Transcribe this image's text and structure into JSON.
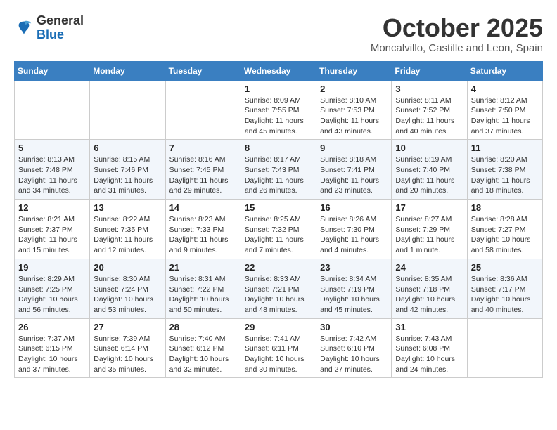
{
  "logo": {
    "general": "General",
    "blue": "Blue"
  },
  "title": "October 2025",
  "location": "Moncalvillo, Castille and Leon, Spain",
  "days_of_week": [
    "Sunday",
    "Monday",
    "Tuesday",
    "Wednesday",
    "Thursday",
    "Friday",
    "Saturday"
  ],
  "weeks": [
    [
      {
        "day": "",
        "info": ""
      },
      {
        "day": "",
        "info": ""
      },
      {
        "day": "",
        "info": ""
      },
      {
        "day": "1",
        "sunrise": "Sunrise: 8:09 AM",
        "sunset": "Sunset: 7:55 PM",
        "daylight": "Daylight: 11 hours and 45 minutes."
      },
      {
        "day": "2",
        "sunrise": "Sunrise: 8:10 AM",
        "sunset": "Sunset: 7:53 PM",
        "daylight": "Daylight: 11 hours and 43 minutes."
      },
      {
        "day": "3",
        "sunrise": "Sunrise: 8:11 AM",
        "sunset": "Sunset: 7:52 PM",
        "daylight": "Daylight: 11 hours and 40 minutes."
      },
      {
        "day": "4",
        "sunrise": "Sunrise: 8:12 AM",
        "sunset": "Sunset: 7:50 PM",
        "daylight": "Daylight: 11 hours and 37 minutes."
      }
    ],
    [
      {
        "day": "5",
        "sunrise": "Sunrise: 8:13 AM",
        "sunset": "Sunset: 7:48 PM",
        "daylight": "Daylight: 11 hours and 34 minutes."
      },
      {
        "day": "6",
        "sunrise": "Sunrise: 8:15 AM",
        "sunset": "Sunset: 7:46 PM",
        "daylight": "Daylight: 11 hours and 31 minutes."
      },
      {
        "day": "7",
        "sunrise": "Sunrise: 8:16 AM",
        "sunset": "Sunset: 7:45 PM",
        "daylight": "Daylight: 11 hours and 29 minutes."
      },
      {
        "day": "8",
        "sunrise": "Sunrise: 8:17 AM",
        "sunset": "Sunset: 7:43 PM",
        "daylight": "Daylight: 11 hours and 26 minutes."
      },
      {
        "day": "9",
        "sunrise": "Sunrise: 8:18 AM",
        "sunset": "Sunset: 7:41 PM",
        "daylight": "Daylight: 11 hours and 23 minutes."
      },
      {
        "day": "10",
        "sunrise": "Sunrise: 8:19 AM",
        "sunset": "Sunset: 7:40 PM",
        "daylight": "Daylight: 11 hours and 20 minutes."
      },
      {
        "day": "11",
        "sunrise": "Sunrise: 8:20 AM",
        "sunset": "Sunset: 7:38 PM",
        "daylight": "Daylight: 11 hours and 18 minutes."
      }
    ],
    [
      {
        "day": "12",
        "sunrise": "Sunrise: 8:21 AM",
        "sunset": "Sunset: 7:37 PM",
        "daylight": "Daylight: 11 hours and 15 minutes."
      },
      {
        "day": "13",
        "sunrise": "Sunrise: 8:22 AM",
        "sunset": "Sunset: 7:35 PM",
        "daylight": "Daylight: 11 hours and 12 minutes."
      },
      {
        "day": "14",
        "sunrise": "Sunrise: 8:23 AM",
        "sunset": "Sunset: 7:33 PM",
        "daylight": "Daylight: 11 hours and 9 minutes."
      },
      {
        "day": "15",
        "sunrise": "Sunrise: 8:25 AM",
        "sunset": "Sunset: 7:32 PM",
        "daylight": "Daylight: 11 hours and 7 minutes."
      },
      {
        "day": "16",
        "sunrise": "Sunrise: 8:26 AM",
        "sunset": "Sunset: 7:30 PM",
        "daylight": "Daylight: 11 hours and 4 minutes."
      },
      {
        "day": "17",
        "sunrise": "Sunrise: 8:27 AM",
        "sunset": "Sunset: 7:29 PM",
        "daylight": "Daylight: 11 hours and 1 minute."
      },
      {
        "day": "18",
        "sunrise": "Sunrise: 8:28 AM",
        "sunset": "Sunset: 7:27 PM",
        "daylight": "Daylight: 10 hours and 58 minutes."
      }
    ],
    [
      {
        "day": "19",
        "sunrise": "Sunrise: 8:29 AM",
        "sunset": "Sunset: 7:25 PM",
        "daylight": "Daylight: 10 hours and 56 minutes."
      },
      {
        "day": "20",
        "sunrise": "Sunrise: 8:30 AM",
        "sunset": "Sunset: 7:24 PM",
        "daylight": "Daylight: 10 hours and 53 minutes."
      },
      {
        "day": "21",
        "sunrise": "Sunrise: 8:31 AM",
        "sunset": "Sunset: 7:22 PM",
        "daylight": "Daylight: 10 hours and 50 minutes."
      },
      {
        "day": "22",
        "sunrise": "Sunrise: 8:33 AM",
        "sunset": "Sunset: 7:21 PM",
        "daylight": "Daylight: 10 hours and 48 minutes."
      },
      {
        "day": "23",
        "sunrise": "Sunrise: 8:34 AM",
        "sunset": "Sunset: 7:19 PM",
        "daylight": "Daylight: 10 hours and 45 minutes."
      },
      {
        "day": "24",
        "sunrise": "Sunrise: 8:35 AM",
        "sunset": "Sunset: 7:18 PM",
        "daylight": "Daylight: 10 hours and 42 minutes."
      },
      {
        "day": "25",
        "sunrise": "Sunrise: 8:36 AM",
        "sunset": "Sunset: 7:17 PM",
        "daylight": "Daylight: 10 hours and 40 minutes."
      }
    ],
    [
      {
        "day": "26",
        "sunrise": "Sunrise: 7:37 AM",
        "sunset": "Sunset: 6:15 PM",
        "daylight": "Daylight: 10 hours and 37 minutes."
      },
      {
        "day": "27",
        "sunrise": "Sunrise: 7:39 AM",
        "sunset": "Sunset: 6:14 PM",
        "daylight": "Daylight: 10 hours and 35 minutes."
      },
      {
        "day": "28",
        "sunrise": "Sunrise: 7:40 AM",
        "sunset": "Sunset: 6:12 PM",
        "daylight": "Daylight: 10 hours and 32 minutes."
      },
      {
        "day": "29",
        "sunrise": "Sunrise: 7:41 AM",
        "sunset": "Sunset: 6:11 PM",
        "daylight": "Daylight: 10 hours and 30 minutes."
      },
      {
        "day": "30",
        "sunrise": "Sunrise: 7:42 AM",
        "sunset": "Sunset: 6:10 PM",
        "daylight": "Daylight: 10 hours and 27 minutes."
      },
      {
        "day": "31",
        "sunrise": "Sunrise: 7:43 AM",
        "sunset": "Sunset: 6:08 PM",
        "daylight": "Daylight: 10 hours and 24 minutes."
      },
      {
        "day": "",
        "info": ""
      }
    ]
  ]
}
